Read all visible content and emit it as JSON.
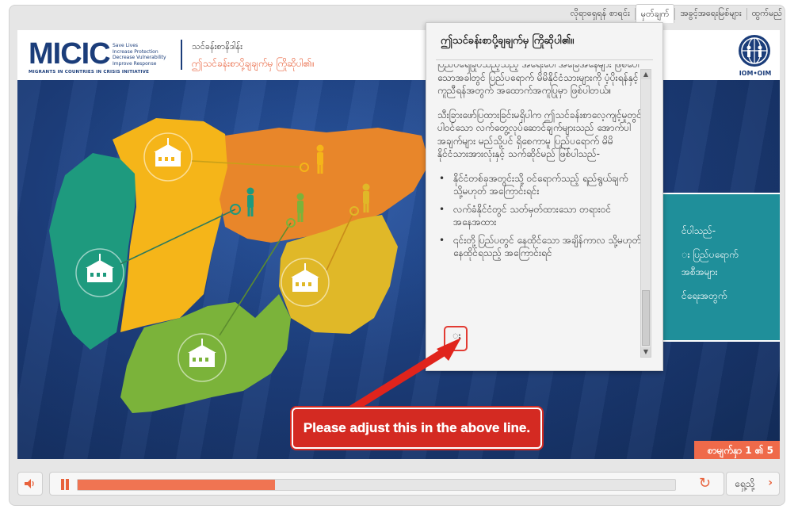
{
  "topmenu": {
    "items": [
      "လိုရာရှေရန် စာရင်း",
      "မှတ်ချက်",
      "အခွင့်အရေးမြစ်များ",
      "ထွက်မည်"
    ],
    "active_index": 1
  },
  "header": {
    "logo_text": "MICIC",
    "logo_tagline": [
      "Save Lives",
      "Increase Protection",
      "Decrease Vulnerability",
      "Improve Response"
    ],
    "logo_subtitle": "MIGRANTS IN COUNTRIES IN CRISIS INITIATIVE",
    "course_title": "သင်ခန်းစာနိဒါန်း",
    "lesson_title": "ဤသင်ခန်းစာပို့ချချက်မှ ကြိုဆိုပါ၏။",
    "partner_logo_label": "IOM•OIM"
  },
  "popup": {
    "title": "ဤသင်ခန်းစာပို့ချချက်မှ ကြိုဆိုပါ၏။",
    "paragraph_1": "ပြည်ပရေခြုပ်သည့်သည့် အရေးပေါ်အခြေအနေများ ဖြစ်ပေါ်သောအခါတွင် ပြည်ပရောက် မိမိနိုင်ငံသားများကို ပံ့ပိုးရန်နှင့် ကူညီရန်အတွက် အထောက်အကူပြုမှာ ဖြစ်ပါတယ်။",
    "paragraph_2": "သီးခြားဖော်ပြထားခြင်းမရှိပါက ဤသင်ခန်းစာလေ့ကျင့်မှုတွင် ပါဝင်သော လက်တွေ့လုပ်ဆောင်ချက်များသည် အောက်ပါအချက်များ မည်သို့ပင် ရှိစေကာမူ ပြည်ပရောက် မိမိနိုင်ငံသားအားလုံးနှင့် သက်ဆိုင်မည် ဖြစ်ပါသည်-",
    "bullets": [
      "နိုင်ငံတစ်ခုအတွင်းသို့ ဝင်ရောက်သည့် ရည်ရွယ်ချက် သို့မဟုတ် အကြောင်းရင်း",
      "လက်ခံနိုင်ငံတွင် သတ်မှတ်ထားသော တရားဝင်အနေအထား",
      "၎င်းတို့ပြည်ပတွင် နေထိုင်သော အချိန်ကာလ သို့မဟုတ် နေထိုင်ရသည့် အကြောင်းရင်"
    ],
    "cursor_glyph": "း"
  },
  "teal_panel": {
    "lines": [
      "င်ပါသည်-",
      "း ပြည်ပရောက်",
      "အစီအများ",
      "င်ရေးအတွက်"
    ]
  },
  "annotation": {
    "callout_text": "Please adjust this in the above line."
  },
  "page_indicator": "စာမျက်နှာ 1 ၏ 5",
  "player": {
    "progress_fraction": 0.33,
    "next_label": "ရှေ့သို့",
    "next_icon": "chevron-right-icon",
    "volume_icon": "speaker-icon",
    "pause_icon": "pause-icon",
    "replay_icon": "replay-icon"
  },
  "colors": {
    "accent": "#e8623c",
    "brand_blue": "#1b3d7a",
    "teal": "#1f8f9a",
    "map_teal": "#1e9a7e",
    "map_yellow": "#f5b519",
    "map_orange": "#e8862a",
    "map_green": "#7bb33a",
    "annotation_red": "#d42a22"
  }
}
